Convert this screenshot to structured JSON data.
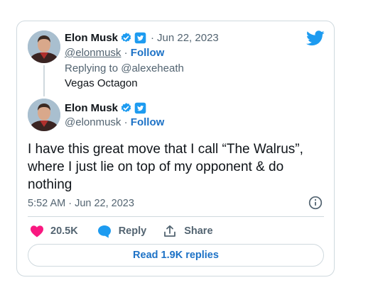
{
  "colors": {
    "accent_blue": "#1d9bf0",
    "link_blue": "#1d72c6",
    "like_pink": "#f91880",
    "muted_text": "#536471",
    "border": "#cfd9de"
  },
  "icons": {
    "logo": "twitter-bird-icon",
    "verified": "verified-badge-icon",
    "affiliate": "twitter-square-badge-icon",
    "info": "info-circle-icon",
    "like": "heart-icon",
    "reply": "speech-bubble-icon",
    "share": "share-upload-icon"
  },
  "parent_tweet": {
    "display_name": "Elon Musk",
    "separator": "·",
    "date": "Jun 22, 2023",
    "handle": "@elonmusk",
    "follow_sep": " · ",
    "follow_label": "Follow",
    "replying_to": "Replying to @alexeheath",
    "text": "Vegas Octagon"
  },
  "tweet": {
    "display_name": "Elon Musk",
    "handle": "@elonmusk",
    "follow_sep": " · ",
    "follow_label": "Follow",
    "text_lines": [
      "I have this great move that I call “The Walrus”,",
      "where I just lie on top of my opponent & do",
      "nothing"
    ],
    "timestamp": "5:52 AM · Jun 22, 2023"
  },
  "actions": {
    "like_count": "20.5K",
    "reply_label": "Reply",
    "share_label": "Share",
    "read_replies_label": "Read 1.9K replies"
  }
}
